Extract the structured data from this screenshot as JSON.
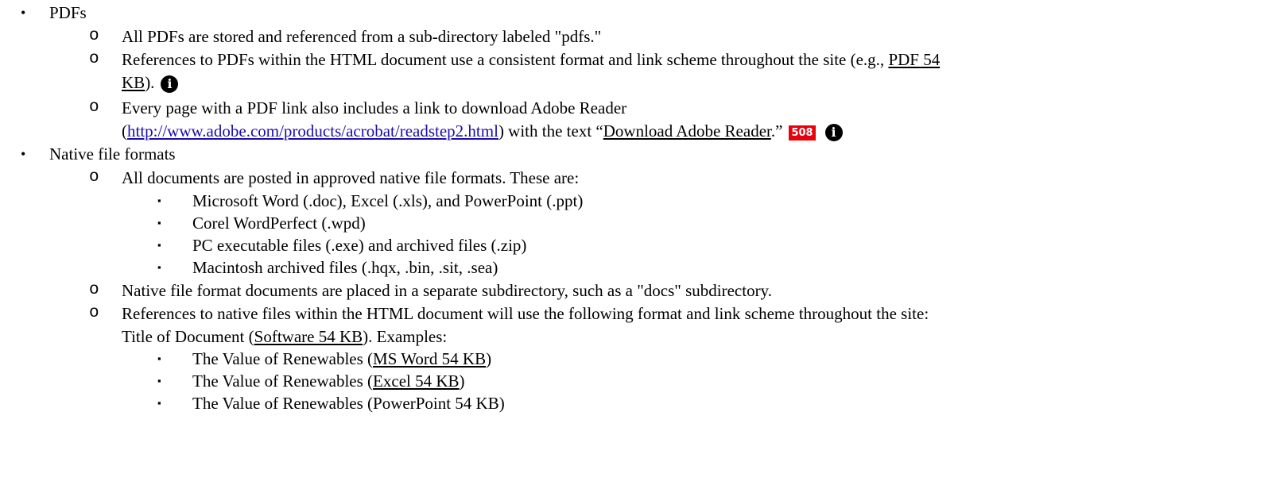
{
  "pdfs": {
    "heading": "PDFs",
    "stored": "All PDFs are stored and referenced from a sub-directory labeled \"pdfs.\"",
    "refs_line1_prefix": "References to PDFs within the HTML document use a consistent format and link scheme throughout the site (e.g., ",
    "refs_link_part1": "PDF 54",
    "refs_link_part2": "KB",
    "refs_line2_suffix": ").",
    "reader_line1": "Every page with a PDF link also includes a link to download Adobe Reader",
    "reader_open_paren": "(",
    "reader_url": "http://www.adobe.com/products/acrobat/readstep2.html",
    "reader_mid_text": ") with the text “",
    "reader_link_text": "Download Adobe Reader",
    "reader_close": ".”",
    "badge_508": "508",
    "info_glyph": "i"
  },
  "native": {
    "heading": "Native file formats",
    "approved": "All documents are posted in approved native file formats. These are:",
    "formats": [
      "Microsoft Word (.doc), Excel (.xls), and PowerPoint (.ppt)",
      "Corel WordPerfect (.wpd)",
      "PC executable files (.exe) and archived files (.zip)",
      "Macintosh archived files (.hqx, .bin, .sit, .sea)"
    ],
    "subdir": "Native file format documents are placed in a separate subdirectory, such as a \"docs\" subdirectory.",
    "refs_line1": "References to native files within the HTML document will use the following format and link scheme throughout the site:",
    "refs_line2_prefix": "Title of Document (",
    "refs_line2_link": "Software 54 KB",
    "refs_line2_suffix": "). Examples:",
    "examples": [
      {
        "prefix": "The Value of Renewables (",
        "link": "MS Word 54 KB",
        "suffix": ")"
      },
      {
        "prefix": "The Value of Renewables (",
        "link": "Excel 54 KB",
        "suffix": ")"
      },
      {
        "prefix": "The Value of Renewables (",
        "link": "PowerPoint 54 KB",
        "suffix": ")"
      }
    ]
  },
  "markers": {
    "disc": "•",
    "circle": "o",
    "square": "▪"
  },
  "colors": {
    "badge_bg": "#e8000b",
    "url_link": "#1a0dab",
    "text": "#000000"
  },
  "icons": [
    "info-icon",
    "section-508-icon"
  ]
}
